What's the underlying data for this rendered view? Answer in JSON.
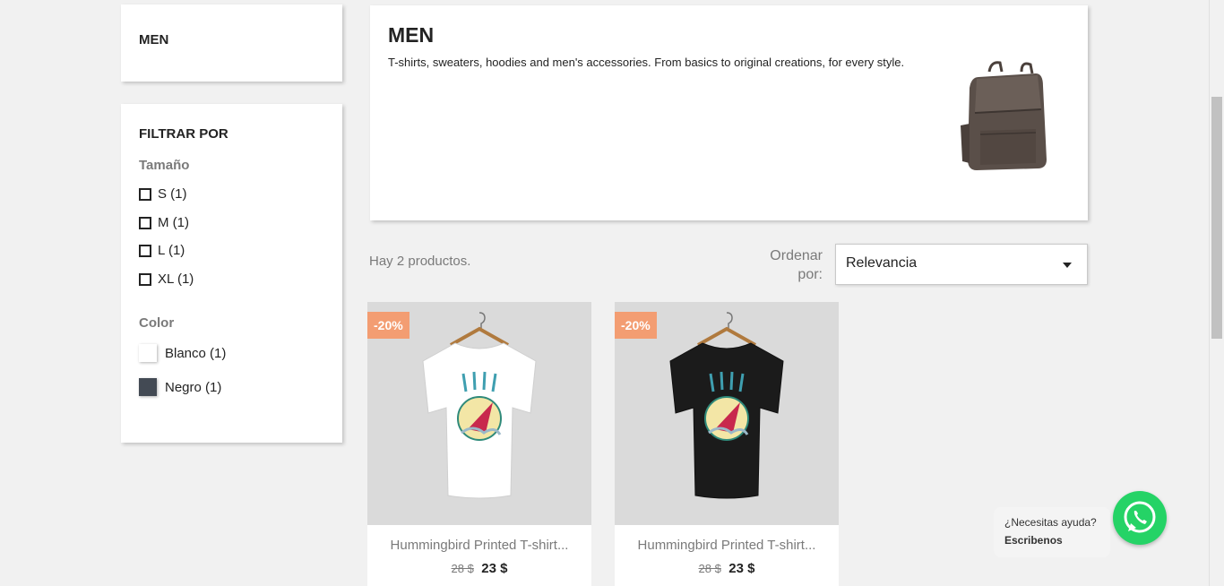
{
  "category_block": {
    "title": "MEN"
  },
  "filters": {
    "title": "FILTRAR POR",
    "size_facet": {
      "label": "Tamaño",
      "options": [
        "S (1)",
        "M (1)",
        "L (1)",
        "XL (1)"
      ]
    },
    "color_facet": {
      "label": "Color",
      "options": [
        {
          "label": "Blanco (1)",
          "color": "#ffffff"
        },
        {
          "label": "Negro (1)",
          "color": "#434a54"
        }
      ]
    }
  },
  "category_header": {
    "title": "MEN",
    "description": "T-shirts, sweaters, hoodies and men's accessories. From basics to original creations, for every style."
  },
  "listing": {
    "count_text": "Hay 2 productos.",
    "sort_label": "Ordenar por:",
    "sort_value": "Relevancia"
  },
  "products": [
    {
      "badge": "-20%",
      "name": "Hummingbird Printed T-shirt...",
      "old_price": "28 $",
      "price": "23 $",
      "shirt_color": "#ffffff"
    },
    {
      "badge": "-20%",
      "name": "Hummingbird Printed T-shirt...",
      "old_price": "28 $",
      "price": "23 $",
      "shirt_color": "#1b1b1b"
    }
  ],
  "help_widget": {
    "question": "¿Necesitas ayuda?",
    "cta": "Escribenos"
  },
  "colors": {
    "discount_badge": "#f39d72",
    "whatsapp": "#25d366"
  }
}
